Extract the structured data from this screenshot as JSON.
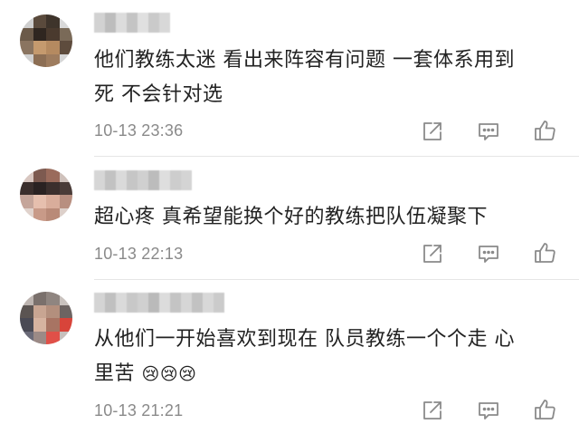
{
  "comments": [
    {
      "text_lines": [
        "他们教练太迷 看出来阵容有问题 一套体系用到",
        "死 不会针对选"
      ],
      "time": "10-13 23:36",
      "actions": {
        "share_icon": "share-icon",
        "comment_icon": "comment-icon",
        "like_icon": "like-icon"
      }
    },
    {
      "text_lines": [
        "超心疼 真希望能换个好的教练把队伍凝聚下"
      ],
      "time": "10-13 22:13",
      "actions": {
        "share_icon": "share-icon",
        "comment_icon": "comment-icon",
        "like_icon": "like-icon"
      }
    },
    {
      "text_lines": [
        "从他们一开始喜欢到现在 队员教练一个个走 心",
        "里苦"
      ],
      "emoji": "😢😢😢",
      "time": "10-13 21:21",
      "actions": {
        "share_icon": "share-icon",
        "comment_icon": "comment-icon",
        "like_icon": "like-icon"
      }
    }
  ],
  "colors": {
    "text": "#222222",
    "time": "#8a8a8a",
    "icon": "#8a8a8a",
    "divider": "#e6e6e6"
  }
}
